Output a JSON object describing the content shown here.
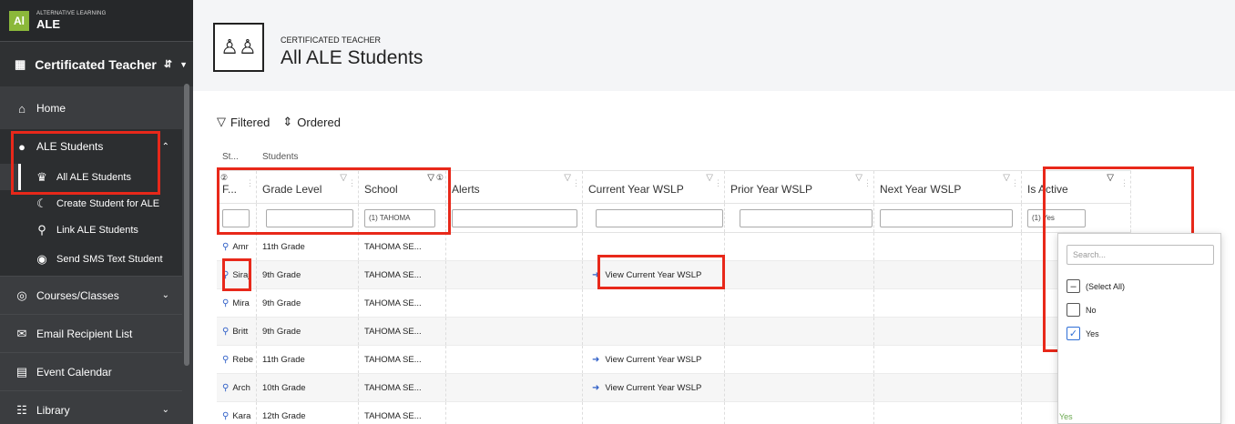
{
  "brand": {
    "logo": "Al",
    "small": "ALTERNATIVE LEARNING",
    "name": "ALE"
  },
  "role": {
    "label": "Certificated Teacher"
  },
  "sidebar": {
    "home": "Home",
    "ale_students": "ALE Students",
    "sub_items": [
      "All ALE Students",
      "Create Student for ALE",
      "Link ALE Students",
      "Send SMS Text Student"
    ],
    "courses": "Courses/Classes",
    "email": "Email Recipient List",
    "calendar": "Event Calendar",
    "library": "Library"
  },
  "header": {
    "subtitle": "CERTIFICATED TEACHER",
    "title": "All ALE Students"
  },
  "toolbar": {
    "filtered": "Filtered",
    "ordered": "Ordered"
  },
  "grid": {
    "group_st": "St...",
    "group_students": "Students",
    "columns": [
      "F...",
      "Grade Level",
      "School",
      "Alerts",
      "Current Year WSLP",
      "Prior Year WSLP",
      "Next Year WSLP",
      "Is Active"
    ],
    "sort_marks": {
      "first": "②",
      "school": "①"
    },
    "filters": {
      "school": "(1) TAHOMA",
      "is_active": "(1) Yes"
    },
    "link_label": "View Current Year WSLP",
    "rows": [
      {
        "name": "Amr",
        "grade": "11th Grade",
        "school": "TAHOMA SE...",
        "wslp": ""
      },
      {
        "name": "Siraj",
        "grade": "9th Grade",
        "school": "TAHOMA SE...",
        "wslp": "View Current Year WSLP"
      },
      {
        "name": "Mira",
        "grade": "9th Grade",
        "school": "TAHOMA SE...",
        "wslp": ""
      },
      {
        "name": "Britt",
        "grade": "9th Grade",
        "school": "TAHOMA SE...",
        "wslp": ""
      },
      {
        "name": "Rebe",
        "grade": "11th Grade",
        "school": "TAHOMA SE...",
        "wslp": "View Current Year WSLP"
      },
      {
        "name": "Arch",
        "grade": "10th Grade",
        "school": "TAHOMA SE...",
        "wslp": "View Current Year WSLP"
      },
      {
        "name": "Kara",
        "grade": "12th Grade",
        "school": "TAHOMA SE...",
        "wslp": ""
      }
    ]
  },
  "dropdown": {
    "search_placeholder": "Search...",
    "options": [
      {
        "label": "(Select All)",
        "state": "indeterminate"
      },
      {
        "label": "No",
        "state": "unchecked"
      },
      {
        "label": "Yes",
        "state": "checked"
      }
    ],
    "peek": "Yes"
  },
  "colors": {
    "annotation": "#e8281a",
    "brand_green": "#8bb83a",
    "link_blue": "#2f5fc7",
    "sidebar_bg": "#3b3d40"
  }
}
